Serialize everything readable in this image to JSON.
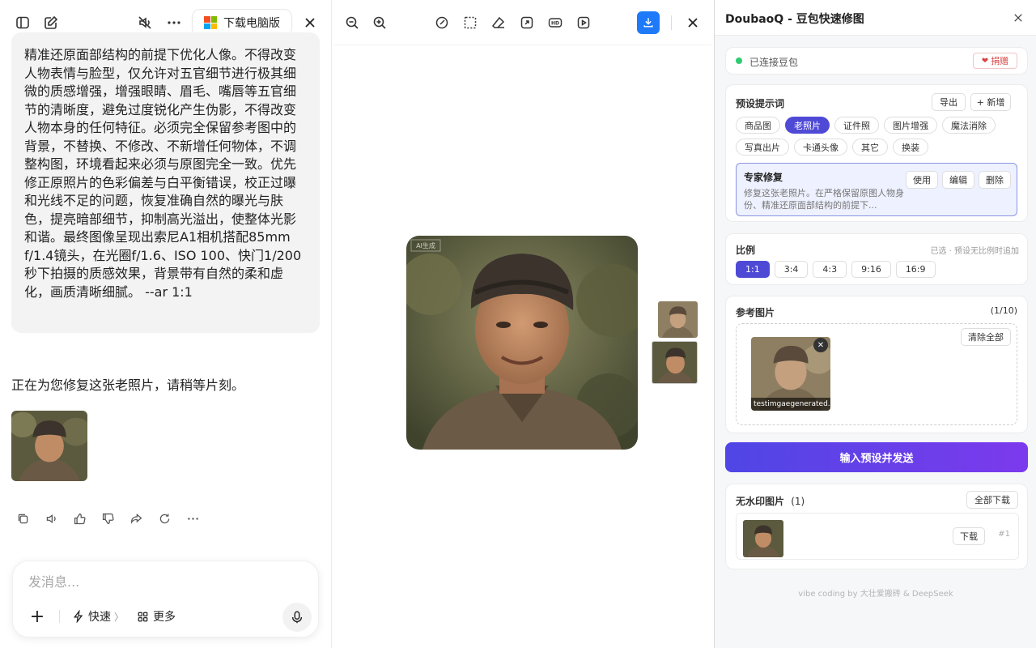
{
  "left": {
    "download_pc": "下载电脑版",
    "prompt_text": "精准还原面部结构的前提下优化人像。不得改变人物表情与脸型，仅允许对五官细节进行极其细微的质感增强，增强眼睛、眉毛、嘴唇等五官细节的清晰度，避免过度锐化产生伪影，不得改变人物本身的任何特征。必须完全保留参考图中的背景，不替换、不修改、不新增任何物体，不调整构图，环境看起来必须与原图完全一致。优先修正原照片的色彩偏差与白平衡错误，校正过曝和光线不足的问题，恢复准确自然的曝光与肤色，提亮暗部细节，抑制高光溢出，使整体光影和谐。最终图像呈现出索尼A1相机搭配85mm f/1.4镜头，在光圈f/1.6、ISO 100、快门1/200秒下拍摄的质感效果，背景带有自然的柔和虚化，画质清晰细腻。 --ar 1:1",
    "reply": "正在为您修复这张老照片，请稍等片刻。",
    "composer_placeholder": "发消息...",
    "quick_label": "快速",
    "more_label": "更多"
  },
  "viewer": {
    "watermark": "AI生成"
  },
  "ext": {
    "title": "DoubaoQ - 豆包快速修图",
    "connected": "已连接豆包",
    "donate": "捐赠",
    "preset_title": "预设提示词",
    "export": "导出",
    "add": "+ 新增",
    "tags": [
      "商品图",
      "老照片",
      "证件照",
      "图片增强",
      "魔法消除",
      "写真出片",
      "卡通头像",
      "其它",
      "换装"
    ],
    "active_tag": "老照片",
    "expert_title": "专家修复",
    "expert_desc": "修复这张老照片。在严格保留原图人物身份、精准还原面部结构的前提下...",
    "use": "使用",
    "edit": "编辑",
    "delete": "删除",
    "ratio_title": "比例",
    "ratio_note": "已选 · 预设无比例时追加",
    "ratios": [
      "1:1",
      "3:4",
      "4:3",
      "9:16",
      "16:9"
    ],
    "active_ratio": "1:1",
    "ref_title": "参考图片",
    "ref_count": "(1/10)",
    "clear_all": "清除全部",
    "ref_name": "testimgaegenerated...",
    "send": "输入预设并发送",
    "nowm_title": "无水印图片",
    "nowm_count": "(1)",
    "download_all": "全部下载",
    "download": "下载",
    "nowm_idx": "#1",
    "footer": "vibe coding by 大壮爱搬砖 & DeepSeek"
  },
  "colors": {
    "accent": "#4f4ad6",
    "download_blue": "#1e7af8",
    "connected_green": "#2ecc71",
    "donate_red": "#d64545"
  }
}
